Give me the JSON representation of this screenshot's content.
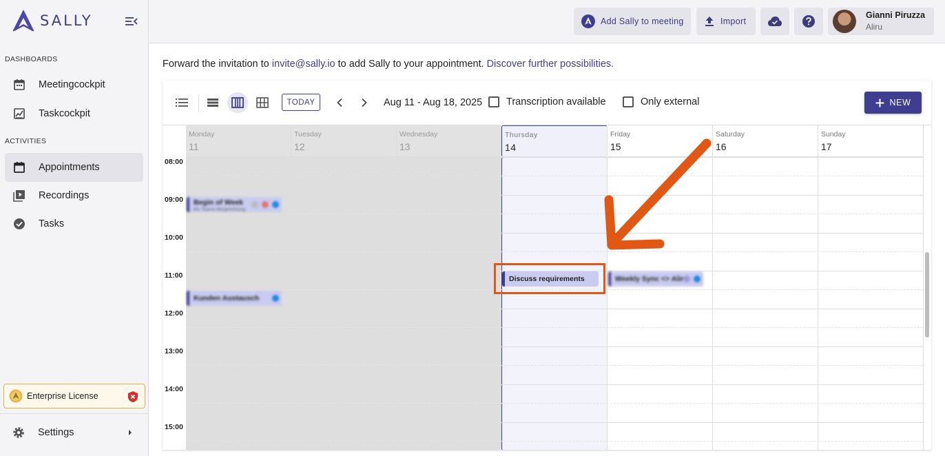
{
  "app": {
    "brand": "SALLY",
    "accent_color": "#3f3d8f",
    "annotation_color": "#e15815"
  },
  "sidebar": {
    "sections": [
      {
        "label": "DASHBOARDS"
      },
      {
        "label": "ACTIVITIES"
      }
    ],
    "items": [
      {
        "label": "Meetingcockpit",
        "icon": "calendar-icon"
      },
      {
        "label": "Taskcockpit",
        "icon": "chart-icon"
      },
      {
        "label": "Appointments",
        "icon": "calendar-icon",
        "active": true
      },
      {
        "label": "Recordings",
        "icon": "play-library-icon"
      },
      {
        "label": "Tasks",
        "icon": "check-circle-icon"
      }
    ],
    "license": {
      "label": "Enterprise License"
    },
    "settings": {
      "label": "Settings"
    }
  },
  "topbar": {
    "add_to_meeting": "Add Sally to meeting",
    "import": "Import",
    "user": {
      "name": "Gianni Piruzza",
      "org": "Aliru"
    }
  },
  "invite": {
    "prefix": "Forward the invitation to ",
    "email": "invite@sally.io",
    "middle": " to add Sally to your appointment. ",
    "link": "Discover further possibilities."
  },
  "calendar": {
    "today_label": "TODAY",
    "range": "Aug 11 - Aug 18, 2025",
    "filters": {
      "transcription": "Transcription available",
      "external": "Only external"
    },
    "new_label": "NEW",
    "days": [
      {
        "name": "Monday",
        "num": "11",
        "state": "past"
      },
      {
        "name": "Tuesday",
        "num": "12",
        "state": "past"
      },
      {
        "name": "Wednesday",
        "num": "13",
        "state": "past"
      },
      {
        "name": "Thursday",
        "num": "14",
        "state": "today"
      },
      {
        "name": "Friday",
        "num": "15",
        "state": "future"
      },
      {
        "name": "Saturday",
        "num": "16",
        "state": "future"
      },
      {
        "name": "Sunday",
        "num": "17",
        "state": "future"
      }
    ],
    "times": [
      "08:00",
      "09:00",
      "10:00",
      "11:00",
      "12:00",
      "13:00",
      "14:00",
      "15:00"
    ],
    "events": [
      {
        "title": "Begin of Week",
        "subtitle": "Ms Teams Besprechung",
        "blurred": true
      },
      {
        "title": "Kunden Austausch",
        "blurred": true
      },
      {
        "title": "Discuss requirements",
        "blurred": false,
        "highlighted": true
      },
      {
        "title": "Weekly Sync <> Aliru",
        "blurred": true
      }
    ]
  }
}
